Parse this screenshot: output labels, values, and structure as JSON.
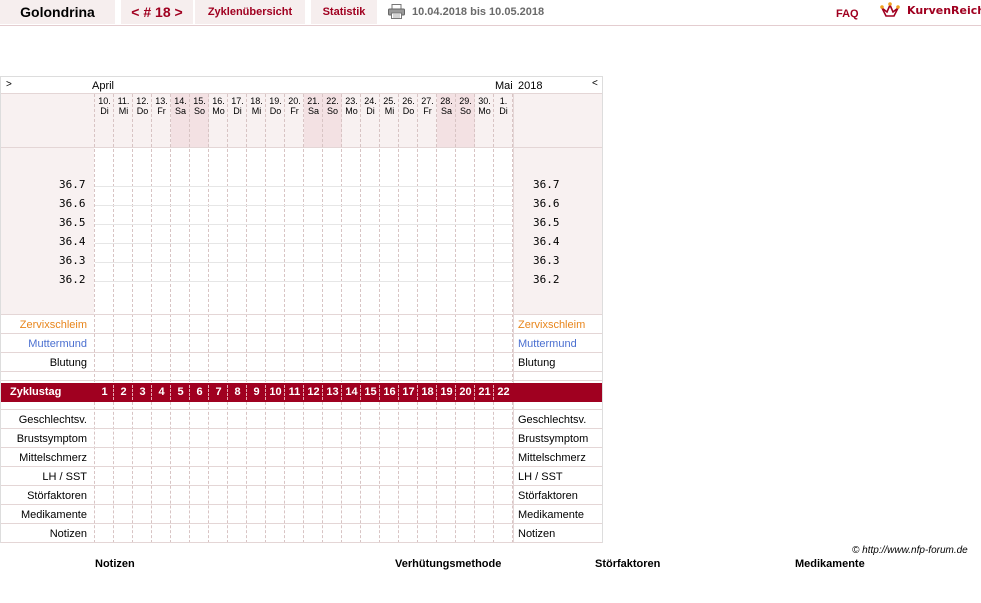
{
  "header": {
    "user": "Golondrina",
    "cycle_number": "< # 18 >",
    "overview": "Zyklenübersicht",
    "statistics": "Statistik",
    "date_range": "10.04.2018 bis 10.05.2018",
    "faq": "FAQ",
    "brand": "KurvenReich"
  },
  "chart": {
    "nav_left": ">",
    "nav_right": "<",
    "month_start": "April",
    "month_end": "Mai",
    "year": "2018",
    "days": [
      {
        "d": "10.",
        "w": "Di"
      },
      {
        "d": "11.",
        "w": "Mi"
      },
      {
        "d": "12.",
        "w": "Do"
      },
      {
        "d": "13.",
        "w": "Fr"
      },
      {
        "d": "14.",
        "w": "Sa"
      },
      {
        "d": "15.",
        "w": "So"
      },
      {
        "d": "16.",
        "w": "Mo"
      },
      {
        "d": "17.",
        "w": "Di"
      },
      {
        "d": "18.",
        "w": "Mi"
      },
      {
        "d": "19.",
        "w": "Do"
      },
      {
        "d": "20.",
        "w": "Fr"
      },
      {
        "d": "21.",
        "w": "Sa"
      },
      {
        "d": "22.",
        "w": "So"
      },
      {
        "d": "23.",
        "w": "Mo"
      },
      {
        "d": "24.",
        "w": "Di"
      },
      {
        "d": "25.",
        "w": "Mi"
      },
      {
        "d": "26.",
        "w": "Do"
      },
      {
        "d": "27.",
        "w": "Fr"
      },
      {
        "d": "28.",
        "w": "Sa"
      },
      {
        "d": "29.",
        "w": "So"
      },
      {
        "d": "30.",
        "w": "Mo"
      },
      {
        "d": "1.",
        "w": "Di"
      }
    ],
    "weekend_indices": [
      4,
      5,
      11,
      12,
      18,
      19
    ],
    "temperatures": [
      "36.7",
      "36.6",
      "36.5",
      "36.4",
      "36.3",
      "36.2"
    ],
    "rows_top": {
      "zervixschleim": "Zervixschleim",
      "muttermund": "Muttermund",
      "blutung": "Blutung"
    },
    "zyklustag_label": "Zyklustag",
    "cycle_days": [
      "1",
      "2",
      "3",
      "4",
      "5",
      "6",
      "7",
      "8",
      "9",
      "10",
      "11",
      "12",
      "13",
      "14",
      "15",
      "16",
      "17",
      "18",
      "19",
      "20",
      "21",
      "22"
    ],
    "rows_bottom": [
      "Geschlechtsv.",
      "Brustsymptom",
      "Mittelschmerz",
      "LH / SST",
      "Störfaktoren",
      "Medikamente",
      "Notizen"
    ],
    "colors": {
      "accent": "#a00020",
      "zervix": "#e8851b",
      "muttermund": "#4a6fd0"
    }
  },
  "footer": {
    "copyright": "© http://www.nfp-forum.de",
    "notizen": "Notizen",
    "verhuetung": "Verhütungsmethode",
    "stoerfaktoren": "Störfaktoren",
    "medikamente": "Medikamente"
  }
}
